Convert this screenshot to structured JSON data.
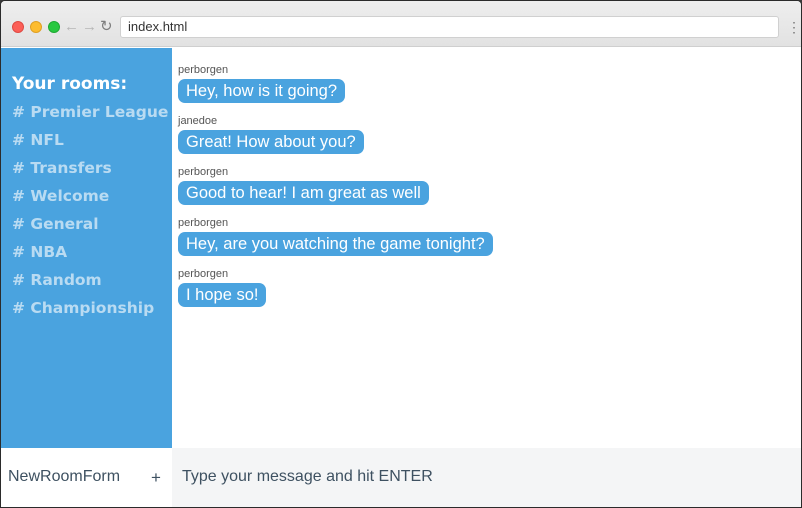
{
  "browser": {
    "url": "index.html",
    "icons": {
      "back": "arrow-left-icon",
      "forward": "arrow-right-icon",
      "reload": "reload-icon",
      "menu": "kebab-menu-icon"
    }
  },
  "sidebar": {
    "title": "Your rooms:",
    "rooms": [
      "# Premier League",
      "# NFL",
      "# Transfers",
      "# Welcome",
      "# General",
      "# NBA",
      "# Random",
      "# Championship"
    ]
  },
  "messages": [
    {
      "user": "perborgen",
      "text": "Hey, how is it going?"
    },
    {
      "user": "janedoe",
      "text": "Great! How about you?"
    },
    {
      "user": "perborgen",
      "text": "Good to hear! I am great as well"
    },
    {
      "user": "perborgen",
      "text": "Hey, are you watching the game tonight?"
    },
    {
      "user": "perborgen",
      "text": "I hope so!"
    }
  ],
  "new_room_form": {
    "placeholder": "NewRoomForm",
    "button": "+"
  },
  "send_form": {
    "placeholder": "Type your message and hit ENTER"
  },
  "colors": {
    "accent": "#4aa3df",
    "room_text": "#b9dbf2",
    "input_bg": "#f4f5f6"
  }
}
